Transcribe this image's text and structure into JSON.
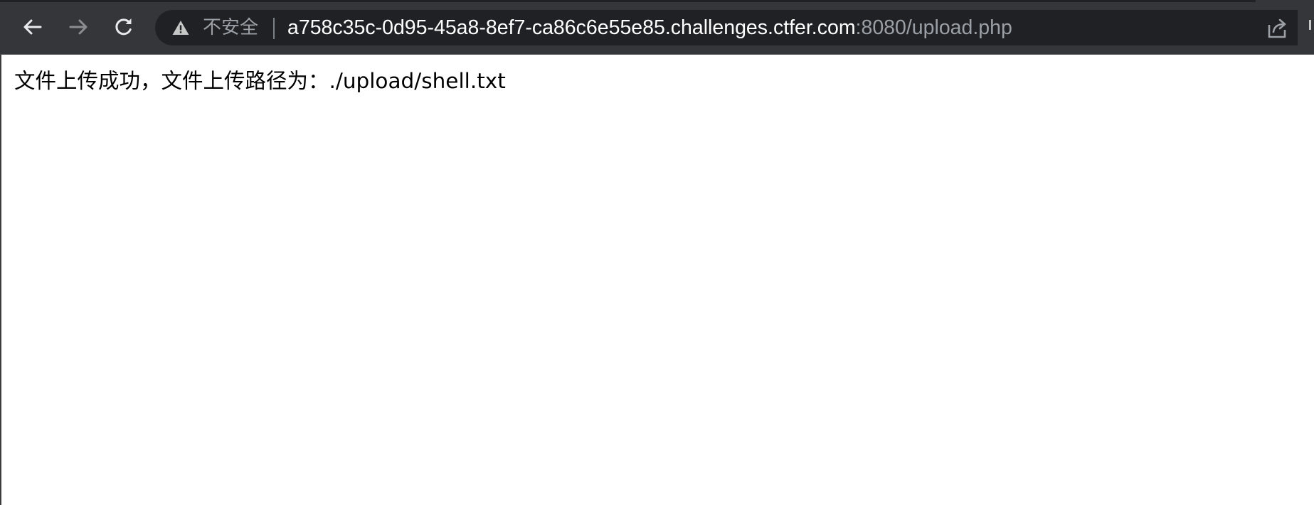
{
  "browser": {
    "security_label": "不安全",
    "url_host": "a758c35c-0d95-45a8-8ef7-ca86c6e55e85.challenges.ctfer.com",
    "url_rest": ":8080/upload.php",
    "icons": {
      "back": "arrow-left-icon",
      "forward": "arrow-right-icon",
      "reload": "reload-icon",
      "security": "warning-triangle-icon",
      "share": "share-icon"
    }
  },
  "page": {
    "message": "文件上传成功，文件上传路径为：./upload/shell.txt"
  },
  "colors": {
    "toolbar": "#35363a",
    "omnibox": "#202124",
    "url_host": "#ffffff",
    "url_muted": "#9aa0a6",
    "page_background": "#ffffff",
    "text": "#000000"
  }
}
